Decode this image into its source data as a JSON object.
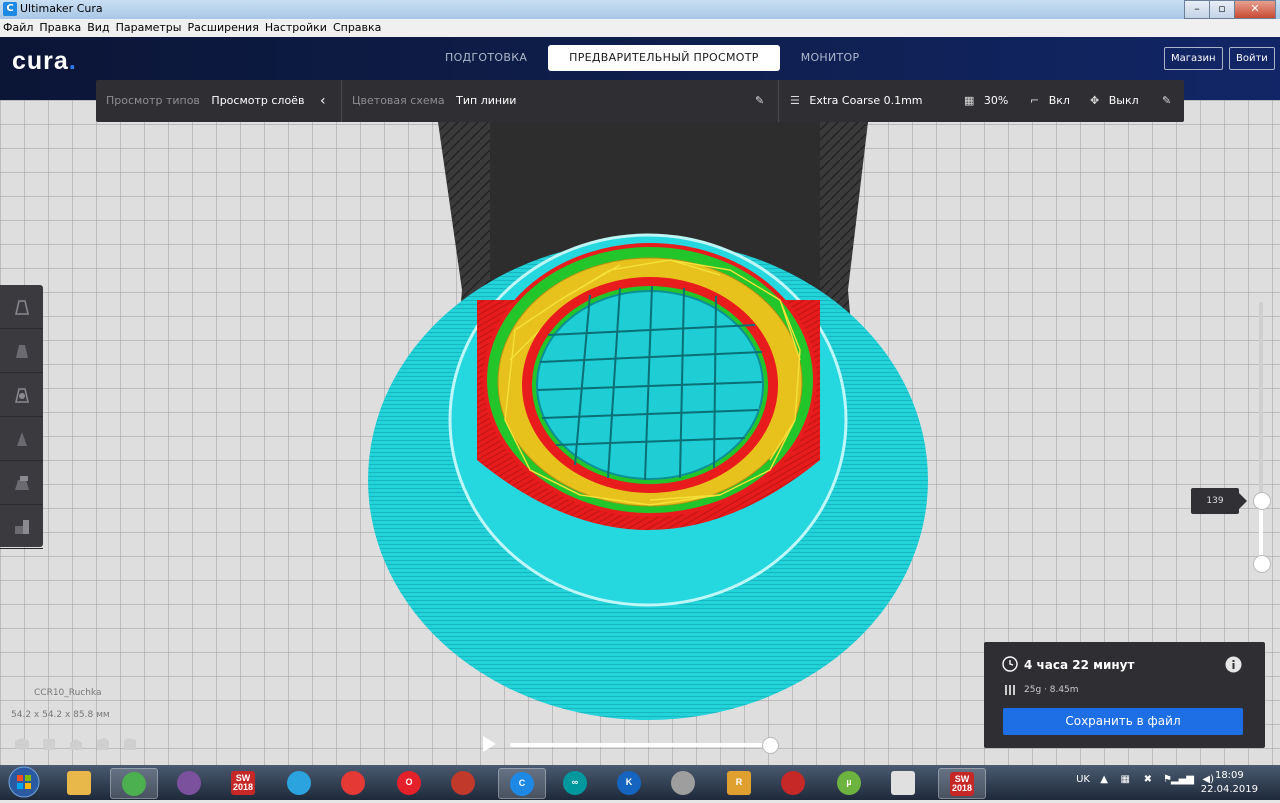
{
  "window": {
    "title": "Ultimaker Cura",
    "app_icon": "C",
    "controls": [
      "–",
      "▫",
      "✕"
    ]
  },
  "menu": [
    "Файл",
    "Правка",
    "Вид",
    "Параметры",
    "Расширения",
    "Настройки",
    "Справка"
  ],
  "header": {
    "logo": "cura",
    "tabs": [
      {
        "label": "ПОДГОТОВКА",
        "active": false
      },
      {
        "label": "ПРЕДВАРИТЕЛЬНЫЙ ПРОСМОТР",
        "active": true
      },
      {
        "label": "МОНИТОР",
        "active": false
      }
    ],
    "marketplace": "Магазин",
    "signin": "Войти"
  },
  "toolbar": {
    "view_type_label": "Просмотр типов",
    "view_type_value": "Просмотр слоёв",
    "color_scheme_label": "Цветовая схема",
    "color_scheme_value": "Тип линии",
    "profile": "Extra Coarse 0.1mm",
    "infill": "30%",
    "support": "Вкл",
    "adhesion": "Выкл"
  },
  "object": {
    "name": "CCR10_Ruchka",
    "dimensions": "54.2 x 54.2 x 85.8 мм"
  },
  "layer_slider": {
    "current_layer": "139"
  },
  "playback": {
    "progress": 1.0
  },
  "summary": {
    "print_time": "4 часа 22 минут",
    "material": "25g · 8.45m",
    "save_button": "Сохранить в файл"
  },
  "taskbar": {
    "apps": [
      {
        "name": "explorer",
        "glyph": "",
        "color": "#e8b84a"
      },
      {
        "name": "chrome",
        "glyph": "",
        "color": "#4caf50",
        "active": true
      },
      {
        "name": "viber",
        "glyph": "",
        "color": "#7b519d"
      },
      {
        "name": "solidworks",
        "glyph": "SW\n2018",
        "color": "#c62828"
      },
      {
        "name": "telegram",
        "glyph": "",
        "color": "#2aa3de"
      },
      {
        "name": "photo",
        "glyph": "",
        "color": "#e53935"
      },
      {
        "name": "opera",
        "glyph": "O",
        "color": "#e4202a"
      },
      {
        "name": "3d-app",
        "glyph": "",
        "color": "#c0392b"
      },
      {
        "name": "cura",
        "glyph": "C",
        "color": "#1e88e5",
        "active": true
      },
      {
        "name": "arduino",
        "glyph": "∞",
        "color": "#00979d"
      },
      {
        "name": "k-app",
        "glyph": "K",
        "color": "#1565c0"
      },
      {
        "name": "tools",
        "glyph": "",
        "color": "#9e9e9e"
      },
      {
        "name": "r-app",
        "glyph": "R",
        "color": "#e0a030"
      },
      {
        "name": "gear-app",
        "glyph": "",
        "color": "#c62828"
      },
      {
        "name": "utorrent",
        "glyph": "µ",
        "color": "#6db33f"
      },
      {
        "name": "window-app",
        "glyph": "",
        "color": "#e0e0e0"
      },
      {
        "name": "solidworks-2",
        "glyph": "SW\n2018",
        "color": "#c62828",
        "active": true
      }
    ],
    "language": "UK",
    "time": "18:09",
    "date": "22.04.2019"
  },
  "colors": {
    "header_bg": "#0f1f4e",
    "accent": "#1e6fe5",
    "panel": "#2e2e33",
    "model_skin": "#1ad0d8",
    "model_wall": "#e81c1c",
    "model_support": "#e8c21c",
    "model_outer": "#22c522"
  }
}
